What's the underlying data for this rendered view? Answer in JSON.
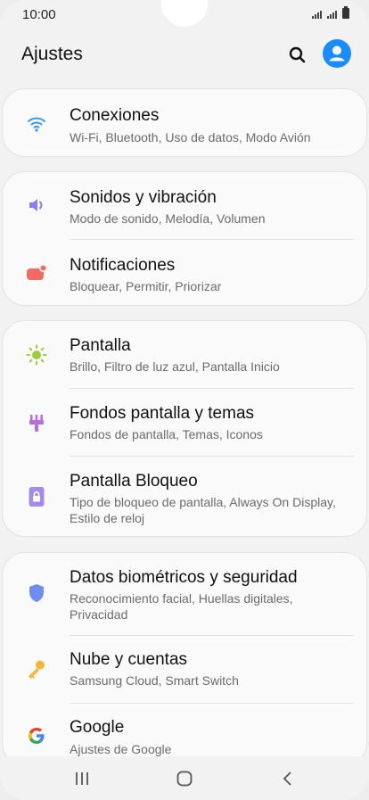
{
  "status": {
    "time": "10:00"
  },
  "header": {
    "title": "Ajustes",
    "search_icon": "search-icon",
    "profile_icon": "profile-icon"
  },
  "colors": {
    "accent": "#1a8cff",
    "wifi": "#3b9bf2",
    "sound": "#8e7cf0",
    "notif": "#f06b63",
    "display": "#9ccc3a",
    "wallpaper": "#b86ce0",
    "lock": "#a48be6",
    "biometrics": "#6f8df0",
    "key": "#f3b83a",
    "google_blue": "#4285f4"
  },
  "sections": [
    {
      "items": [
        {
          "title": "Conexiones",
          "subtitle": "Wi-Fi, Bluetooth, Uso de datos, Modo Avión",
          "icon": "wifi-icon"
        }
      ]
    },
    {
      "items": [
        {
          "title": "Sonidos y vibración",
          "subtitle": "Modo de sonido, Melodía, Volumen",
          "icon": "speaker-icon"
        },
        {
          "title": "Notificaciones",
          "subtitle": "Bloquear, Permitir, Priorizar",
          "icon": "notification-icon"
        }
      ]
    },
    {
      "items": [
        {
          "title": "Pantalla",
          "subtitle": "Brillo, Filtro de luz azul, Pantalla Inicio",
          "icon": "brightness-icon"
        },
        {
          "title": "Fondos pantalla y temas",
          "subtitle": "Fondos de pantalla, Temas, Iconos",
          "icon": "brush-icon"
        },
        {
          "title": "Pantalla Bloqueo",
          "subtitle": "Tipo de bloqueo de pantalla, Always On Display, Estilo de reloj",
          "icon": "lock-icon"
        }
      ]
    },
    {
      "items": [
        {
          "title": "Datos biométricos y seguridad",
          "subtitle": "Reconocimiento facial, Huellas digitales, Privacidad",
          "icon": "shield-icon"
        },
        {
          "title": "Nube y cuentas",
          "subtitle": "Samsung Cloud, Smart Switch",
          "icon": "key-icon"
        },
        {
          "title": "Google",
          "subtitle": "Ajustes de Google",
          "icon": "google-icon"
        }
      ]
    }
  ],
  "navbar": {
    "recents_icon": "recents-icon",
    "home_icon": "home-icon",
    "back_icon": "back-icon"
  }
}
